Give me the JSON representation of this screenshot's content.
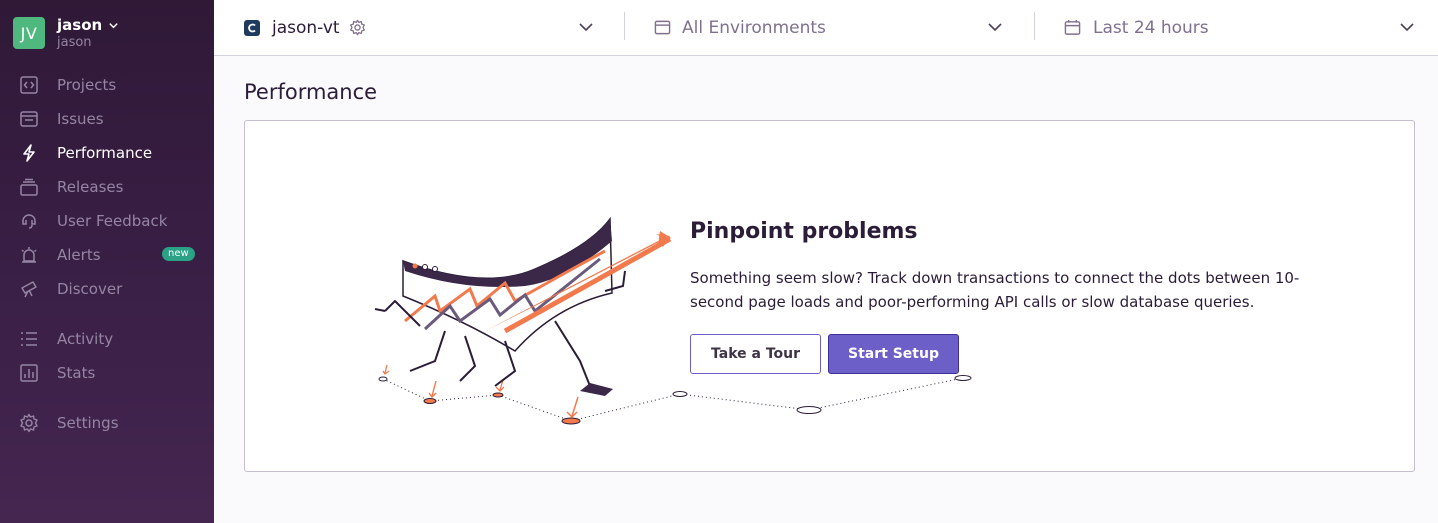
{
  "org": {
    "initials": "JV",
    "name": "jason",
    "subname": "jason"
  },
  "nav": [
    {
      "label": "Projects",
      "icon": "projects-icon"
    },
    {
      "label": "Issues",
      "icon": "issues-icon"
    },
    {
      "label": "Performance",
      "icon": "lightning-icon",
      "active": true
    },
    {
      "label": "Releases",
      "icon": "releases-icon"
    },
    {
      "label": "User Feedback",
      "icon": "feedback-icon"
    },
    {
      "label": "Alerts",
      "icon": "siren-icon",
      "badge": "new"
    },
    {
      "label": "Discover",
      "icon": "telescope-icon"
    },
    {
      "label": "Activity",
      "icon": "list-icon"
    },
    {
      "label": "Stats",
      "icon": "stats-icon"
    },
    {
      "label": "Settings",
      "icon": "gear-icon"
    }
  ],
  "topbar": {
    "project": "jason-vt",
    "environment": "All Environments",
    "timerange": "Last 24 hours"
  },
  "page": {
    "title": "Performance"
  },
  "empty_state": {
    "headline": "Pinpoint problems",
    "description": "Something seem slow? Track down transactions to connect the dots between 10-second page loads and poor-performing API calls or slow database queries.",
    "tour_label": "Take a Tour",
    "setup_label": "Start Setup"
  },
  "colors": {
    "accent": "#6c5fc7",
    "sidebar": "#2f1937",
    "badge": "#2ba185",
    "avatar": "#4fb87f",
    "orange": "#f27a4c"
  }
}
